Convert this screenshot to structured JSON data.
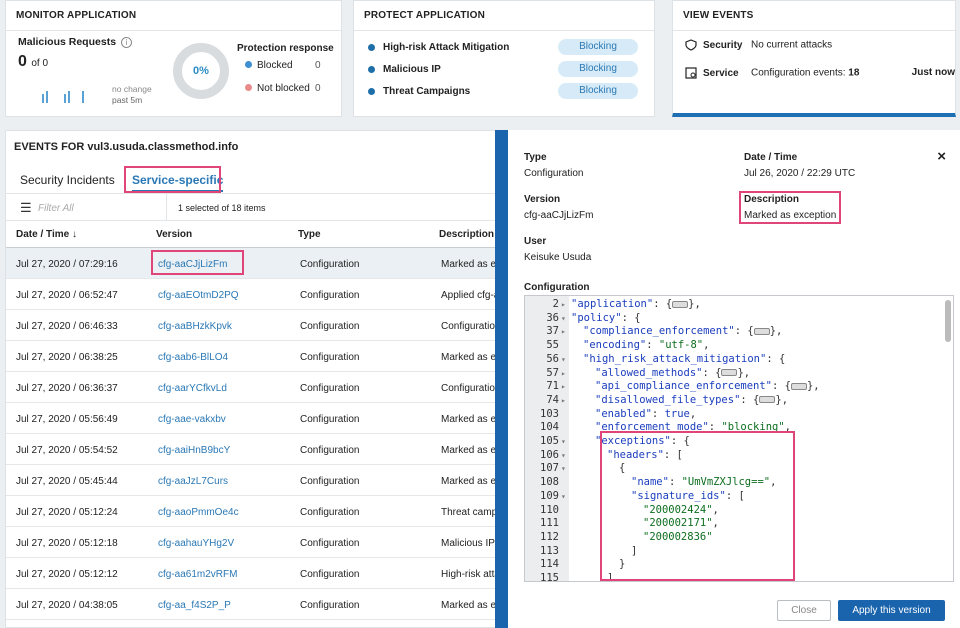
{
  "monitor": {
    "title": "MONITOR APPLICATION",
    "malicious_label": "Malicious Requests",
    "info_glyph": "i",
    "count": "0",
    "of_text": "of 0",
    "change_label": "no change",
    "change_period": "past 5m",
    "donut_pct": "0%",
    "protection_title": "Protection response",
    "blocked_label": "Blocked",
    "blocked_value": "0",
    "not_blocked_label": "Not blocked",
    "not_blocked_value": "0",
    "blocked_color": "#3d8fd1",
    "not_blocked_color": "#e88a8a"
  },
  "protect": {
    "title": "PROTECT APPLICATION",
    "items": [
      {
        "label": "High-risk Attack Mitigation",
        "status": "Blocking"
      },
      {
        "label": "Malicious IP",
        "status": "Blocking"
      },
      {
        "label": "Threat Campaigns",
        "status": "Blocking"
      }
    ]
  },
  "view_events": {
    "title": "VIEW EVENTS",
    "security_label": "Security",
    "security_value": "No current attacks",
    "service_label": "Service",
    "service_value_prefix": "Configuration events:",
    "service_value_count": "18",
    "service_time": "Just now"
  },
  "events": {
    "title": "EVENTS FOR vul3.usuda.classmethod.info",
    "tabs": [
      "Security Incidents",
      "Service-specific"
    ],
    "filter_placeholder": "Filter All",
    "selection_text": "1 selected of 18 items",
    "columns": [
      "Date / Time ↓",
      "Version",
      "Type",
      "Description"
    ],
    "rows": [
      {
        "date": "Jul 27, 2020 / 07:29:16",
        "version": "cfg-aaCJjLizFm",
        "type": "Configuration",
        "desc": "Marked as exception"
      },
      {
        "date": "Jul 27, 2020 / 06:52:47",
        "version": "cfg-aaEOtmD2PQ",
        "type": "Configuration",
        "desc": "Applied cfg-aa"
      },
      {
        "date": "Jul 27, 2020 / 06:46:33",
        "version": "cfg-aaBHzkKpvk",
        "type": "Configuration",
        "desc": "Configuration"
      },
      {
        "date": "Jul 27, 2020 / 06:38:25",
        "version": "cfg-aab6-BlLO4",
        "type": "Configuration",
        "desc": "Marked as exception"
      },
      {
        "date": "Jul 27, 2020 / 06:36:37",
        "version": "cfg-aarYCfkvLd",
        "type": "Configuration",
        "desc": "Configuration"
      },
      {
        "date": "Jul 27, 2020 / 05:56:49",
        "version": "cfg-aae-vakxbv",
        "type": "Configuration",
        "desc": "Marked as exception"
      },
      {
        "date": "Jul 27, 2020 / 05:54:52",
        "version": "cfg-aaiHnB9bcY",
        "type": "Configuration",
        "desc": "Marked as exception"
      },
      {
        "date": "Jul 27, 2020 / 05:45:44",
        "version": "cfg-aaJzL7Curs",
        "type": "Configuration",
        "desc": "Marked as exception"
      },
      {
        "date": "Jul 27, 2020 / 05:12:24",
        "version": "cfg-aaoPmmOe4c",
        "type": "Configuration",
        "desc": "Threat campaigns"
      },
      {
        "date": "Jul 27, 2020 / 05:12:18",
        "version": "cfg-aahauYHg2V",
        "type": "Configuration",
        "desc": "Malicious IP"
      },
      {
        "date": "Jul 27, 2020 / 05:12:12",
        "version": "cfg-aa61m2vRFM",
        "type": "Configuration",
        "desc": "High-risk attack"
      },
      {
        "date": "Jul 27, 2020 / 04:38:05",
        "version": "cfg-aa_f4S2P_P",
        "type": "Configuration",
        "desc": "Marked as exception"
      }
    ]
  },
  "detail": {
    "close_glyph": "×",
    "type_label": "Type",
    "type_value": "Configuration",
    "date_label": "Date / Time",
    "date_value": "Jul 26, 2020 / 22:29 UTC",
    "version_label": "Version",
    "version_value": "cfg-aaCJjLizFm",
    "desc_label": "Description",
    "desc_value": "Marked as exception",
    "user_label": "User",
    "user_value": "Keisuke Usuda",
    "config_label": "Configuration",
    "close_button": "Close",
    "apply_button": "Apply this version",
    "code": [
      {
        "n": "2",
        "f": "▸",
        "ind": 1,
        "parts": [
          [
            "k",
            "\"application\""
          ],
          [
            "p",
            ": {"
          ],
          [
            "fold",
            ""
          ],
          [
            "p",
            "},"
          ]
        ]
      },
      {
        "n": "36",
        "f": "▾",
        "ind": 1,
        "parts": [
          [
            "k",
            "\"policy\""
          ],
          [
            "p",
            ": {"
          ]
        ]
      },
      {
        "n": "37",
        "f": "▸",
        "ind": 2,
        "parts": [
          [
            "k",
            "\"compliance_enforcement\""
          ],
          [
            "p",
            ": {"
          ],
          [
            "fold",
            ""
          ],
          [
            "p",
            "},"
          ]
        ]
      },
      {
        "n": "55",
        "f": "",
        "ind": 2,
        "parts": [
          [
            "k",
            "\"encoding\""
          ],
          [
            "p",
            ": "
          ],
          [
            "s",
            "\"utf-8\""
          ],
          [
            "p",
            ","
          ]
        ]
      },
      {
        "n": "56",
        "f": "▾",
        "ind": 2,
        "parts": [
          [
            "k",
            "\"high_risk_attack_mitigation\""
          ],
          [
            "p",
            ": {"
          ]
        ]
      },
      {
        "n": "57",
        "f": "▸",
        "ind": 3,
        "parts": [
          [
            "k",
            "\"allowed_methods\""
          ],
          [
            "p",
            ": {"
          ],
          [
            "fold",
            ""
          ],
          [
            "p",
            "},"
          ]
        ]
      },
      {
        "n": "71",
        "f": "▸",
        "ind": 3,
        "parts": [
          [
            "k",
            "\"api_compliance_enforcement\""
          ],
          [
            "p",
            ": {"
          ],
          [
            "fold",
            ""
          ],
          [
            "p",
            "},"
          ]
        ]
      },
      {
        "n": "74",
        "f": "▸",
        "ind": 3,
        "parts": [
          [
            "k",
            "\"disallowed_file_types\""
          ],
          [
            "p",
            ": {"
          ],
          [
            "fold",
            ""
          ],
          [
            "p",
            "},"
          ]
        ]
      },
      {
        "n": "103",
        "f": "",
        "ind": 3,
        "parts": [
          [
            "k",
            "\"enabled\""
          ],
          [
            "p",
            ": "
          ],
          [
            "k",
            "true"
          ],
          [
            "p",
            ","
          ]
        ]
      },
      {
        "n": "104",
        "f": "",
        "ind": 3,
        "parts": [
          [
            "k",
            "\"enforcement_mode\""
          ],
          [
            "p",
            ": "
          ],
          [
            "s",
            "\"blocking\""
          ],
          [
            "p",
            ","
          ]
        ]
      },
      {
        "n": "105",
        "f": "▾",
        "ind": 3,
        "parts": [
          [
            "k",
            "\"exceptions\""
          ],
          [
            "p",
            ": {"
          ]
        ]
      },
      {
        "n": "106",
        "f": "▾",
        "ind": 4,
        "parts": [
          [
            "k",
            "\"headers\""
          ],
          [
            "p",
            ": ["
          ]
        ]
      },
      {
        "n": "107",
        "f": "▾",
        "ind": 5,
        "parts": [
          [
            "p",
            "{"
          ]
        ]
      },
      {
        "n": "108",
        "f": "",
        "ind": 6,
        "parts": [
          [
            "k",
            "\"name\""
          ],
          [
            "p",
            ": "
          ],
          [
            "s",
            "\"UmVmZXJlcg==\""
          ],
          [
            "p",
            ","
          ]
        ]
      },
      {
        "n": "109",
        "f": "▾",
        "ind": 6,
        "parts": [
          [
            "k",
            "\"signature_ids\""
          ],
          [
            "p",
            ": ["
          ]
        ]
      },
      {
        "n": "110",
        "f": "",
        "ind": 7,
        "parts": [
          [
            "s",
            "\"200002424\""
          ],
          [
            "p",
            ","
          ]
        ]
      },
      {
        "n": "111",
        "f": "",
        "ind": 7,
        "parts": [
          [
            "s",
            "\"200002171\""
          ],
          [
            "p",
            ","
          ]
        ]
      },
      {
        "n": "112",
        "f": "",
        "ind": 7,
        "parts": [
          [
            "s",
            "\"200002836\""
          ]
        ]
      },
      {
        "n": "113",
        "f": "",
        "ind": 6,
        "parts": [
          [
            "p",
            "]"
          ]
        ]
      },
      {
        "n": "114",
        "f": "",
        "ind": 5,
        "parts": [
          [
            "p",
            "}"
          ]
        ]
      },
      {
        "n": "115",
        "f": "",
        "ind": 4,
        "parts": [
          [
            "p",
            "],"
          ]
        ]
      }
    ]
  }
}
